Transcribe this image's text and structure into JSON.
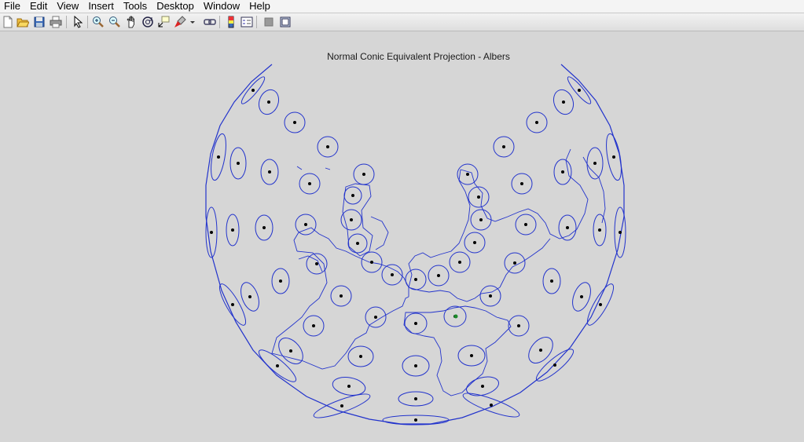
{
  "menu": [
    "File",
    "Edit",
    "View",
    "Insert",
    "Tools",
    "Desktop",
    "Window",
    "Help"
  ],
  "toolbar": [
    "new-figure-icon",
    "open-file-icon",
    "save-icon",
    "print-icon",
    "pointer-icon",
    "zoom-in-icon",
    "zoom-out-icon",
    "pan-icon",
    "rotate-3d-icon",
    "data-cursor-icon",
    "brush-icon",
    "link-plot-icon",
    "colorbar-icon",
    "legend-icon",
    "hide-plot-tools-icon",
    "show-plot-tools-icon"
  ],
  "figure": {
    "title": "Normal Conic Equivalent Projection - Albers",
    "colors": {
      "map_line": "#2233cc",
      "dot": "#000000",
      "background": "#d6d6d6"
    }
  }
}
